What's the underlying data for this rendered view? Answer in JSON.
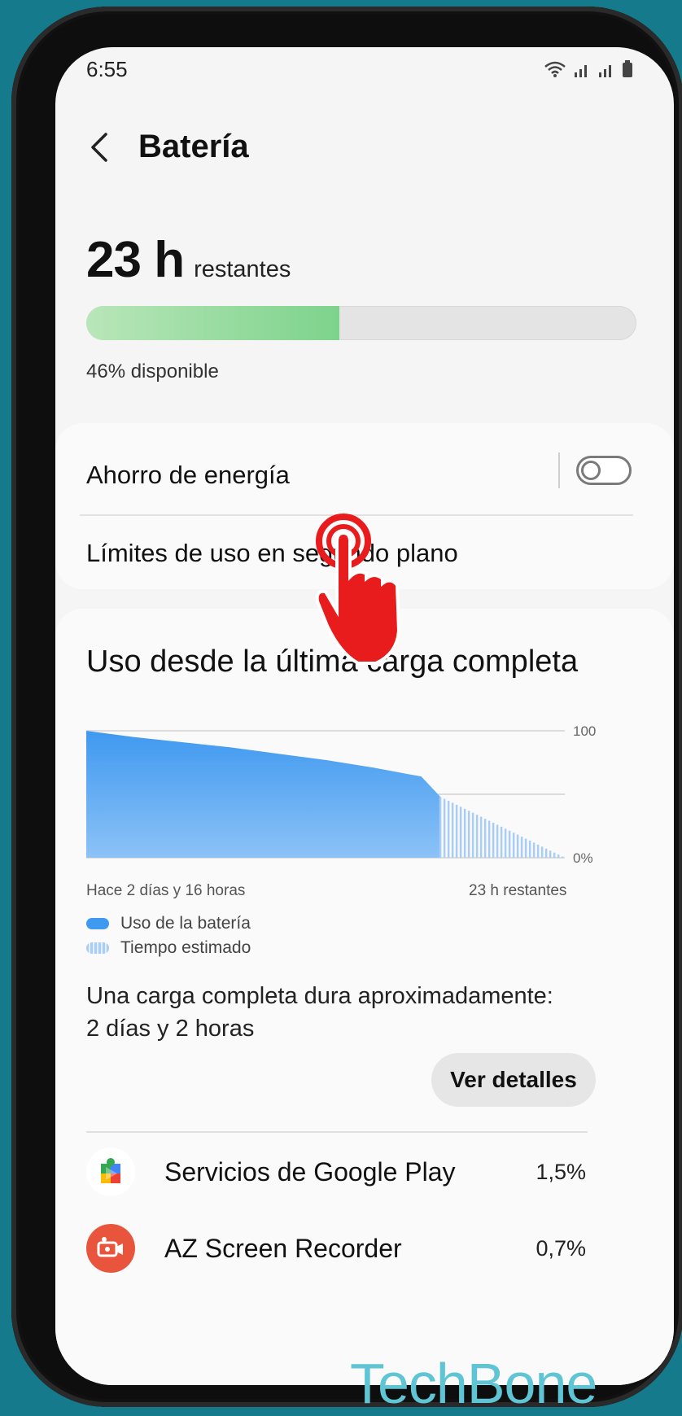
{
  "status_bar": {
    "time": "6:55"
  },
  "header": {
    "title": "Batería"
  },
  "battery": {
    "remaining_value": "23 h",
    "remaining_label": "restantes",
    "level_percent": 46,
    "available_text": "46% disponible"
  },
  "settings": {
    "power_saving_label": "Ahorro de energía",
    "power_saving_on": false,
    "background_limits_label": "Límites de uso en segundo plano"
  },
  "usage": {
    "title": "Uso desde la última carga completa",
    "x_start_label": "Hace 2 días y 16 horas",
    "x_end_label": "23 h restantes",
    "legend_used": "Uso de la batería",
    "legend_estimated": "Tiempo estimado",
    "description_line1": "Una carga completa dura aproximadamente:",
    "description_line2": "2 días y 2 horas",
    "details_button": "Ver detalles"
  },
  "chart_data": {
    "type": "area",
    "y_ticks": [
      "100",
      "0%"
    ],
    "ylim": [
      0,
      100
    ],
    "series": [
      {
        "name": "Uso de la batería",
        "x": [
          0,
          0.1,
          0.2,
          0.3,
          0.4,
          0.5,
          0.6,
          0.7,
          0.74
        ],
        "values": [
          100,
          95,
          91,
          87,
          82,
          77,
          71,
          64,
          48
        ]
      },
      {
        "name": "Tiempo estimado",
        "x": [
          0.74,
          1.0
        ],
        "values": [
          48,
          0
        ]
      }
    ]
  },
  "apps": [
    {
      "name": "Servicios de Google Play",
      "percent": "1,5%",
      "icon": "google-play-services-icon"
    },
    {
      "name": "AZ Screen Recorder",
      "percent": "0,7%",
      "icon": "az-screen-recorder-icon"
    }
  ],
  "watermark": "TechBone",
  "colors": {
    "background": "#157a8c",
    "battery_fill": "#7dd38c",
    "chart_blue": "#3f99f0",
    "chart_estimate": "#a9cdf4",
    "hand_red": "#e81c1c",
    "watermark": "#5fc5d5"
  }
}
